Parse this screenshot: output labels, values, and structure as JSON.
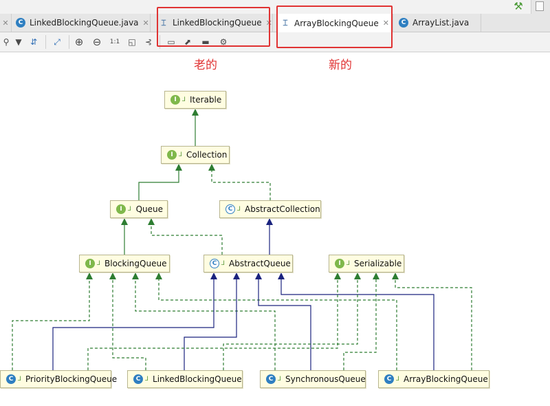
{
  "window": {
    "top_right_icons": [
      "build-hammer-icon",
      "restore-window-icon"
    ]
  },
  "tabs": [
    {
      "label": "LinkedBlockingQueue.java",
      "icon": "java-class-icon",
      "active": false,
      "closable": true
    },
    {
      "label": "LinkedBlockingQueue",
      "icon": "uml-diagram-icon",
      "active": false,
      "closable": true
    },
    {
      "label": "ArrayBlockingQueue",
      "icon": "uml-diagram-icon",
      "active": true,
      "closable": true
    },
    {
      "label": "ArrayList.java",
      "icon": "java-class-icon",
      "active": false,
      "closable": false
    }
  ],
  "toolbar": {
    "buttons": [
      {
        "name": "show-categories-button",
        "glyph": "⚲"
      },
      {
        "name": "filter-button",
        "glyph": "▼"
      },
      {
        "name": "show-dependencies-button",
        "glyph": "⇵"
      },
      {
        "name": "layout-button",
        "glyph": "⤢"
      },
      {
        "name": "zoom-in-button",
        "glyph": "⊕"
      },
      {
        "name": "zoom-out-button",
        "glyph": "⊖"
      },
      {
        "name": "actual-size-button",
        "glyph": "1:1"
      },
      {
        "name": "fit-content-button",
        "glyph": "◱"
      },
      {
        "name": "apply-layout-button",
        "glyph": "⊰"
      },
      {
        "name": "export-button",
        "glyph": "▭"
      },
      {
        "name": "open-in-editor-button",
        "glyph": "⬈"
      },
      {
        "name": "print-button",
        "glyph": "▬"
      },
      {
        "name": "settings-button",
        "glyph": "⚙"
      }
    ]
  },
  "annotations": {
    "old_label": "老的",
    "new_label": "新的",
    "color": "#e03232"
  },
  "diagram": {
    "legend": {
      "interface_badge": "I",
      "class_badge": "C",
      "visibility_glyph": "⅃"
    },
    "colors": {
      "extends": "#1a237e",
      "implements": "#2e7d32",
      "node_fill": "#fffde1",
      "node_border": "#b8b58f"
    },
    "nodes": [
      {
        "id": "Iterable",
        "label": "Iterable",
        "kind": "interface"
      },
      {
        "id": "Collection",
        "label": "Collection",
        "kind": "interface"
      },
      {
        "id": "Queue",
        "label": "Queue",
        "kind": "interface"
      },
      {
        "id": "AbstractCollection",
        "label": "AbstractCollection",
        "kind": "abstract"
      },
      {
        "id": "BlockingQueue",
        "label": "BlockingQueue",
        "kind": "interface"
      },
      {
        "id": "AbstractQueue",
        "label": "AbstractQueue",
        "kind": "abstract"
      },
      {
        "id": "Serializable",
        "label": "Serializable",
        "kind": "interface"
      },
      {
        "id": "PriorityBlockingQueue",
        "label": "PriorityBlockingQueue",
        "kind": "class"
      },
      {
        "id": "LinkedBlockingQueue",
        "label": "LinkedBlockingQueue",
        "kind": "class"
      },
      {
        "id": "SynchronousQueue",
        "label": "SynchronousQueue",
        "kind": "class"
      },
      {
        "id": "ArrayBlockingQueue",
        "label": "ArrayBlockingQueue",
        "kind": "class"
      }
    ],
    "edges": [
      {
        "from": "Collection",
        "to": "Iterable",
        "type": "extends-interface"
      },
      {
        "from": "Queue",
        "to": "Collection",
        "type": "extends-interface"
      },
      {
        "from": "AbstractCollection",
        "to": "Collection",
        "type": "implements"
      },
      {
        "from": "BlockingQueue",
        "to": "Queue",
        "type": "extends-interface"
      },
      {
        "from": "AbstractQueue",
        "to": "Queue",
        "type": "implements"
      },
      {
        "from": "AbstractQueue",
        "to": "AbstractCollection",
        "type": "extends"
      },
      {
        "from": "PriorityBlockingQueue",
        "to": "BlockingQueue",
        "type": "implements"
      },
      {
        "from": "LinkedBlockingQueue",
        "to": "BlockingQueue",
        "type": "implements"
      },
      {
        "from": "SynchronousQueue",
        "to": "BlockingQueue",
        "type": "implements"
      },
      {
        "from": "ArrayBlockingQueue",
        "to": "BlockingQueue",
        "type": "implements"
      },
      {
        "from": "PriorityBlockingQueue",
        "to": "AbstractQueue",
        "type": "extends"
      },
      {
        "from": "LinkedBlockingQueue",
        "to": "AbstractQueue",
        "type": "extends"
      },
      {
        "from": "SynchronousQueue",
        "to": "AbstractQueue",
        "type": "extends"
      },
      {
        "from": "ArrayBlockingQueue",
        "to": "AbstractQueue",
        "type": "extends"
      },
      {
        "from": "PriorityBlockingQueue",
        "to": "Serializable",
        "type": "implements"
      },
      {
        "from": "LinkedBlockingQueue",
        "to": "Serializable",
        "type": "implements"
      },
      {
        "from": "SynchronousQueue",
        "to": "Serializable",
        "type": "implements"
      },
      {
        "from": "ArrayBlockingQueue",
        "to": "Serializable",
        "type": "implements"
      }
    ]
  }
}
